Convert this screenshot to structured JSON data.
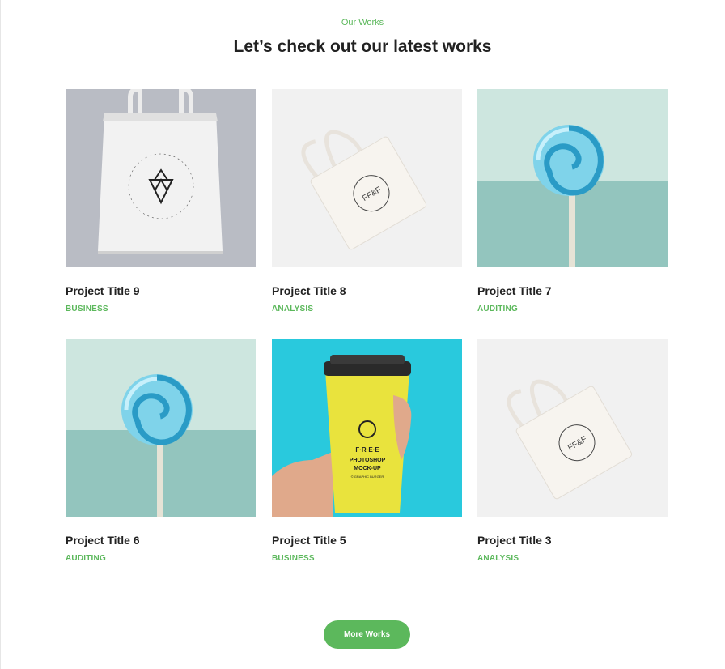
{
  "section": {
    "kicker": "Our Works",
    "heading": "Let’s check out our latest works"
  },
  "projects": [
    {
      "title": "Project Title 9",
      "category": "BUSINESS",
      "image": "tote-bag-hanging"
    },
    {
      "title": "Project Title 8",
      "category": "ANALYSIS",
      "image": "tote-bag-flat"
    },
    {
      "title": "Project Title 7",
      "category": "AUDITING",
      "image": "lollipop"
    },
    {
      "title": "Project Title 6",
      "category": "AUDITING",
      "image": "lollipop"
    },
    {
      "title": "Project Title 5",
      "category": "BUSINESS",
      "image": "coffee-cup-hand"
    },
    {
      "title": "Project Title 3",
      "category": "ANALYSIS",
      "image": "tote-bag-flat"
    }
  ],
  "cup_text": {
    "line1": "F·R·E·E",
    "line2": "PHOTOSHOP",
    "line3": "MOCK-UP",
    "line4": "© GRAPHIC BURGER"
  },
  "bag_monogram": "FF&F",
  "more_button": "More Works",
  "colors": {
    "accent": "#5cb85c",
    "heading": "#222222",
    "lollipop_bg_top": "#cde6df",
    "lollipop_bg_bottom": "#93c5be",
    "cup_bg": "#29c9dd",
    "cup_yellow": "#e9e33d"
  }
}
